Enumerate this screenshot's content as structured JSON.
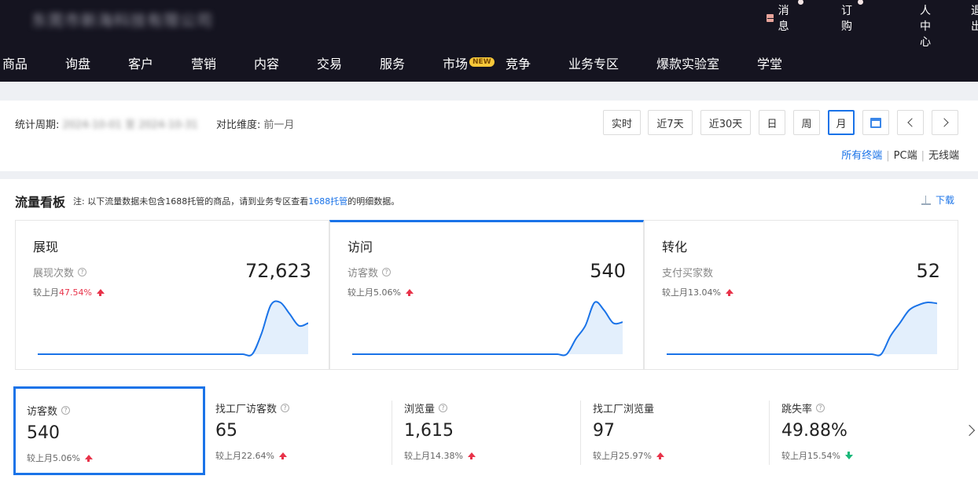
{
  "header": {
    "company": "东莞市新海科技有限公司",
    "links": [
      {
        "label": "消息",
        "icon": "mail-icon",
        "dot": true
      },
      {
        "label": "订购",
        "dot": true
      },
      {
        "label": "个人中心"
      },
      {
        "label": "退出"
      }
    ],
    "nav": [
      "商品",
      "询盘",
      "客户",
      "营销",
      "内容",
      "交易",
      "服务",
      "市场",
      "竞争",
      "业务专区",
      "爆款实验室",
      "学堂"
    ],
    "new_badge": "NEW"
  },
  "filter": {
    "period_label": "统计周期:",
    "period_value": "2024-10-01 至 2024-10-31",
    "compare_label": "对比维度:",
    "compare_value": "前一月",
    "buttons": [
      "实时",
      "近7天",
      "近30天",
      "日",
      "周",
      "月"
    ],
    "active_button": "月",
    "terminals": {
      "all": "所有终端",
      "pc": "PC端",
      "wireless": "无线端"
    }
  },
  "board": {
    "title": "流量看板",
    "note_prefix": "注: 以下流量数据未包含1688托管的商品，请到业务专区查看",
    "note_link": "1688托管",
    "note_suffix": "的明细数据。",
    "download": "下载",
    "cards": [
      {
        "title": "展现",
        "label": "展现次数",
        "value": "72,623",
        "cmp_prefix": "较上月",
        "cmp": "47.54%",
        "trend": "up",
        "has_help": true,
        "spark": [
          0,
          0,
          0,
          0,
          0,
          0,
          0,
          0,
          0,
          0,
          0,
          0,
          0,
          0,
          0,
          0,
          0,
          0,
          0,
          0,
          0,
          0,
          0,
          0,
          0.4,
          0.95,
          1,
          0.78,
          0.55,
          0.6
        ]
      },
      {
        "title": "访问",
        "label": "访客数",
        "value": "540",
        "cmp_prefix": "较上月",
        "cmp": "5.06%",
        "trend": "up",
        "has_help": true,
        "spark": [
          0,
          0,
          0,
          0,
          0,
          0,
          0,
          0,
          0,
          0,
          0,
          0,
          0,
          0,
          0,
          0,
          0,
          0,
          0,
          0,
          0,
          0,
          0,
          0,
          0.3,
          0.55,
          1,
          0.85,
          0.6,
          0.62
        ]
      },
      {
        "title": "转化",
        "label": "支付买家数",
        "value": "52",
        "cmp_prefix": "较上月",
        "cmp": "13.04%",
        "trend": "up",
        "has_help": false,
        "spark": [
          0,
          0,
          0,
          0,
          0,
          0,
          0,
          0,
          0,
          0,
          0,
          0,
          0,
          0,
          0,
          0,
          0,
          0,
          0,
          0,
          0,
          0,
          0,
          0,
          0.35,
          0.6,
          0.85,
          0.95,
          1,
          0.98
        ]
      }
    ],
    "kpis": [
      {
        "label": "访客数",
        "value": "540",
        "cmp_prefix": "较上月",
        "cmp": "5.06%",
        "trend": "up"
      },
      {
        "label": "找工厂访客数",
        "value": "65",
        "cmp_prefix": "较上月",
        "cmp": "22.64%",
        "trend": "up"
      },
      {
        "label": "浏览量",
        "value": "1,615",
        "cmp_prefix": "较上月",
        "cmp": "14.38%",
        "trend": "up"
      },
      {
        "label": "找工厂浏览量",
        "value": "97",
        "cmp_prefix": "较上月",
        "cmp": "25.97%",
        "trend": "up",
        "no_help": true
      },
      {
        "label": "跳失率",
        "value": "49.88%",
        "cmp_prefix": "较上月",
        "cmp": "15.54%",
        "trend": "down"
      }
    ]
  },
  "colors": {
    "accent": "#1a73e8",
    "up": "#e8334a",
    "down": "#1ab87a",
    "header_bg": "#151420"
  }
}
